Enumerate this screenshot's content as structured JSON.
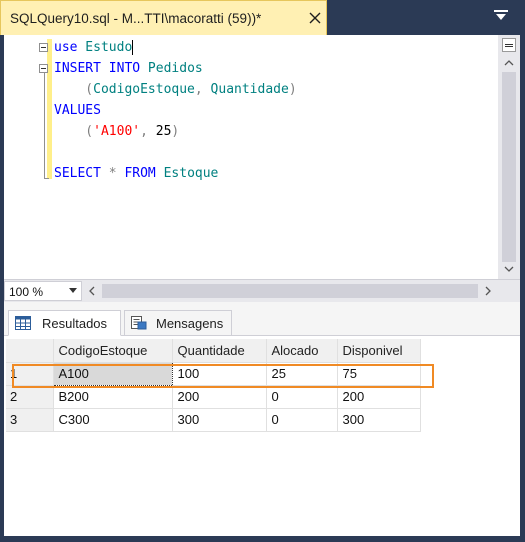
{
  "tab": {
    "title": "SQLQuery10.sql - M...TTI\\macoratti (59))*"
  },
  "editor": {
    "lines": [
      [
        {
          "t": "use",
          "c": "kw"
        },
        {
          "t": " Estudo",
          "c": "id"
        }
      ],
      [
        {
          "t": "INSERT",
          "c": "kw"
        },
        {
          "t": " ",
          "c": "num"
        },
        {
          "t": "INTO",
          "c": "kw"
        },
        {
          "t": " Pedidos",
          "c": "id"
        }
      ],
      [
        {
          "t": "    (",
          "c": "pn"
        },
        {
          "t": "CodigoEstoque",
          "c": "id"
        },
        {
          "t": ", ",
          "c": "pn"
        },
        {
          "t": "Quantidade",
          "c": "id"
        },
        {
          "t": ")",
          "c": "pn"
        }
      ],
      [
        {
          "t": "VALUES",
          "c": "kw"
        }
      ],
      [
        {
          "t": "    (",
          "c": "pn"
        },
        {
          "t": "'A100'",
          "c": "str"
        },
        {
          "t": ", ",
          "c": "pn"
        },
        {
          "t": "25",
          "c": "num"
        },
        {
          "t": ")",
          "c": "pn"
        }
      ],
      [],
      [
        {
          "t": "SELECT",
          "c": "kw"
        },
        {
          "t": " * ",
          "c": "pn"
        },
        {
          "t": "FROM",
          "c": "kw"
        },
        {
          "t": " Estoque",
          "c": "id"
        }
      ]
    ]
  },
  "zoom": {
    "value": "100 %"
  },
  "results": {
    "tabs": [
      {
        "label": "Resultados",
        "icon": "grid-icon",
        "active": true
      },
      {
        "label": "Mensagens",
        "icon": "messages-icon",
        "active": false
      }
    ],
    "columns": [
      "CodigoEstoque",
      "Quantidade",
      "Alocado",
      "Disponivel"
    ],
    "rows": [
      {
        "n": "1",
        "cells": [
          "A100",
          "100",
          "25",
          "75"
        ]
      },
      {
        "n": "2",
        "cells": [
          "B200",
          "200",
          "0",
          "200"
        ]
      },
      {
        "n": "3",
        "cells": [
          "C300",
          "300",
          "0",
          "300"
        ]
      }
    ],
    "highlight_color": "#f08a24"
  }
}
